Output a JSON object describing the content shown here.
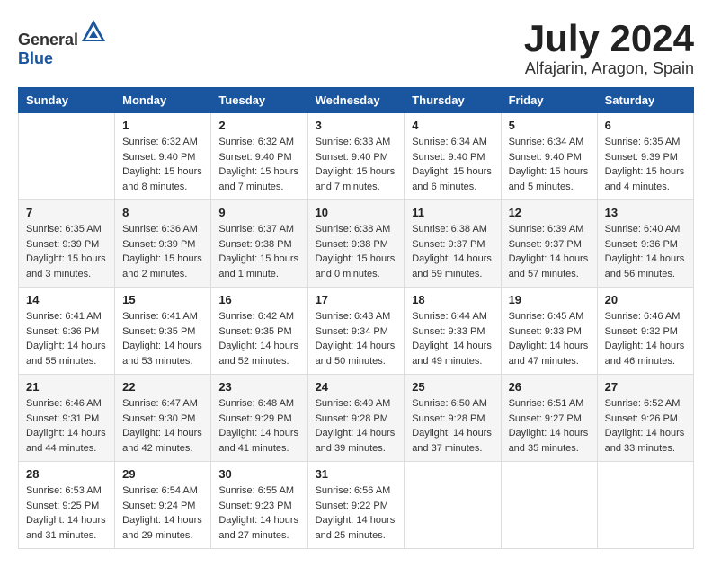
{
  "header": {
    "logo": {
      "general": "General",
      "blue": "Blue"
    },
    "month": "July 2024",
    "location": "Alfajarin, Aragon, Spain"
  },
  "calendar": {
    "days_of_week": [
      "Sunday",
      "Monday",
      "Tuesday",
      "Wednesday",
      "Thursday",
      "Friday",
      "Saturday"
    ],
    "weeks": [
      [
        {
          "day": "",
          "sunrise": "",
          "sunset": "",
          "daylight": ""
        },
        {
          "day": "1",
          "sunrise": "Sunrise: 6:32 AM",
          "sunset": "Sunset: 9:40 PM",
          "daylight": "Daylight: 15 hours and 8 minutes."
        },
        {
          "day": "2",
          "sunrise": "Sunrise: 6:32 AM",
          "sunset": "Sunset: 9:40 PM",
          "daylight": "Daylight: 15 hours and 7 minutes."
        },
        {
          "day": "3",
          "sunrise": "Sunrise: 6:33 AM",
          "sunset": "Sunset: 9:40 PM",
          "daylight": "Daylight: 15 hours and 7 minutes."
        },
        {
          "day": "4",
          "sunrise": "Sunrise: 6:34 AM",
          "sunset": "Sunset: 9:40 PM",
          "daylight": "Daylight: 15 hours and 6 minutes."
        },
        {
          "day": "5",
          "sunrise": "Sunrise: 6:34 AM",
          "sunset": "Sunset: 9:40 PM",
          "daylight": "Daylight: 15 hours and 5 minutes."
        },
        {
          "day": "6",
          "sunrise": "Sunrise: 6:35 AM",
          "sunset": "Sunset: 9:39 PM",
          "daylight": "Daylight: 15 hours and 4 minutes."
        }
      ],
      [
        {
          "day": "7",
          "sunrise": "Sunrise: 6:35 AM",
          "sunset": "Sunset: 9:39 PM",
          "daylight": "Daylight: 15 hours and 3 minutes."
        },
        {
          "day": "8",
          "sunrise": "Sunrise: 6:36 AM",
          "sunset": "Sunset: 9:39 PM",
          "daylight": "Daylight: 15 hours and 2 minutes."
        },
        {
          "day": "9",
          "sunrise": "Sunrise: 6:37 AM",
          "sunset": "Sunset: 9:38 PM",
          "daylight": "Daylight: 15 hours and 1 minute."
        },
        {
          "day": "10",
          "sunrise": "Sunrise: 6:38 AM",
          "sunset": "Sunset: 9:38 PM",
          "daylight": "Daylight: 15 hours and 0 minutes."
        },
        {
          "day": "11",
          "sunrise": "Sunrise: 6:38 AM",
          "sunset": "Sunset: 9:37 PM",
          "daylight": "Daylight: 14 hours and 59 minutes."
        },
        {
          "day": "12",
          "sunrise": "Sunrise: 6:39 AM",
          "sunset": "Sunset: 9:37 PM",
          "daylight": "Daylight: 14 hours and 57 minutes."
        },
        {
          "day": "13",
          "sunrise": "Sunrise: 6:40 AM",
          "sunset": "Sunset: 9:36 PM",
          "daylight": "Daylight: 14 hours and 56 minutes."
        }
      ],
      [
        {
          "day": "14",
          "sunrise": "Sunrise: 6:41 AM",
          "sunset": "Sunset: 9:36 PM",
          "daylight": "Daylight: 14 hours and 55 minutes."
        },
        {
          "day": "15",
          "sunrise": "Sunrise: 6:41 AM",
          "sunset": "Sunset: 9:35 PM",
          "daylight": "Daylight: 14 hours and 53 minutes."
        },
        {
          "day": "16",
          "sunrise": "Sunrise: 6:42 AM",
          "sunset": "Sunset: 9:35 PM",
          "daylight": "Daylight: 14 hours and 52 minutes."
        },
        {
          "day": "17",
          "sunrise": "Sunrise: 6:43 AM",
          "sunset": "Sunset: 9:34 PM",
          "daylight": "Daylight: 14 hours and 50 minutes."
        },
        {
          "day": "18",
          "sunrise": "Sunrise: 6:44 AM",
          "sunset": "Sunset: 9:33 PM",
          "daylight": "Daylight: 14 hours and 49 minutes."
        },
        {
          "day": "19",
          "sunrise": "Sunrise: 6:45 AM",
          "sunset": "Sunset: 9:33 PM",
          "daylight": "Daylight: 14 hours and 47 minutes."
        },
        {
          "day": "20",
          "sunrise": "Sunrise: 6:46 AM",
          "sunset": "Sunset: 9:32 PM",
          "daylight": "Daylight: 14 hours and 46 minutes."
        }
      ],
      [
        {
          "day": "21",
          "sunrise": "Sunrise: 6:46 AM",
          "sunset": "Sunset: 9:31 PM",
          "daylight": "Daylight: 14 hours and 44 minutes."
        },
        {
          "day": "22",
          "sunrise": "Sunrise: 6:47 AM",
          "sunset": "Sunset: 9:30 PM",
          "daylight": "Daylight: 14 hours and 42 minutes."
        },
        {
          "day": "23",
          "sunrise": "Sunrise: 6:48 AM",
          "sunset": "Sunset: 9:29 PM",
          "daylight": "Daylight: 14 hours and 41 minutes."
        },
        {
          "day": "24",
          "sunrise": "Sunrise: 6:49 AM",
          "sunset": "Sunset: 9:28 PM",
          "daylight": "Daylight: 14 hours and 39 minutes."
        },
        {
          "day": "25",
          "sunrise": "Sunrise: 6:50 AM",
          "sunset": "Sunset: 9:28 PM",
          "daylight": "Daylight: 14 hours and 37 minutes."
        },
        {
          "day": "26",
          "sunrise": "Sunrise: 6:51 AM",
          "sunset": "Sunset: 9:27 PM",
          "daylight": "Daylight: 14 hours and 35 minutes."
        },
        {
          "day": "27",
          "sunrise": "Sunrise: 6:52 AM",
          "sunset": "Sunset: 9:26 PM",
          "daylight": "Daylight: 14 hours and 33 minutes."
        }
      ],
      [
        {
          "day": "28",
          "sunrise": "Sunrise: 6:53 AM",
          "sunset": "Sunset: 9:25 PM",
          "daylight": "Daylight: 14 hours and 31 minutes."
        },
        {
          "day": "29",
          "sunrise": "Sunrise: 6:54 AM",
          "sunset": "Sunset: 9:24 PM",
          "daylight": "Daylight: 14 hours and 29 minutes."
        },
        {
          "day": "30",
          "sunrise": "Sunrise: 6:55 AM",
          "sunset": "Sunset: 9:23 PM",
          "daylight": "Daylight: 14 hours and 27 minutes."
        },
        {
          "day": "31",
          "sunrise": "Sunrise: 6:56 AM",
          "sunset": "Sunset: 9:22 PM",
          "daylight": "Daylight: 14 hours and 25 minutes."
        },
        {
          "day": "",
          "sunrise": "",
          "sunset": "",
          "daylight": ""
        },
        {
          "day": "",
          "sunrise": "",
          "sunset": "",
          "daylight": ""
        },
        {
          "day": "",
          "sunrise": "",
          "sunset": "",
          "daylight": ""
        }
      ]
    ]
  }
}
